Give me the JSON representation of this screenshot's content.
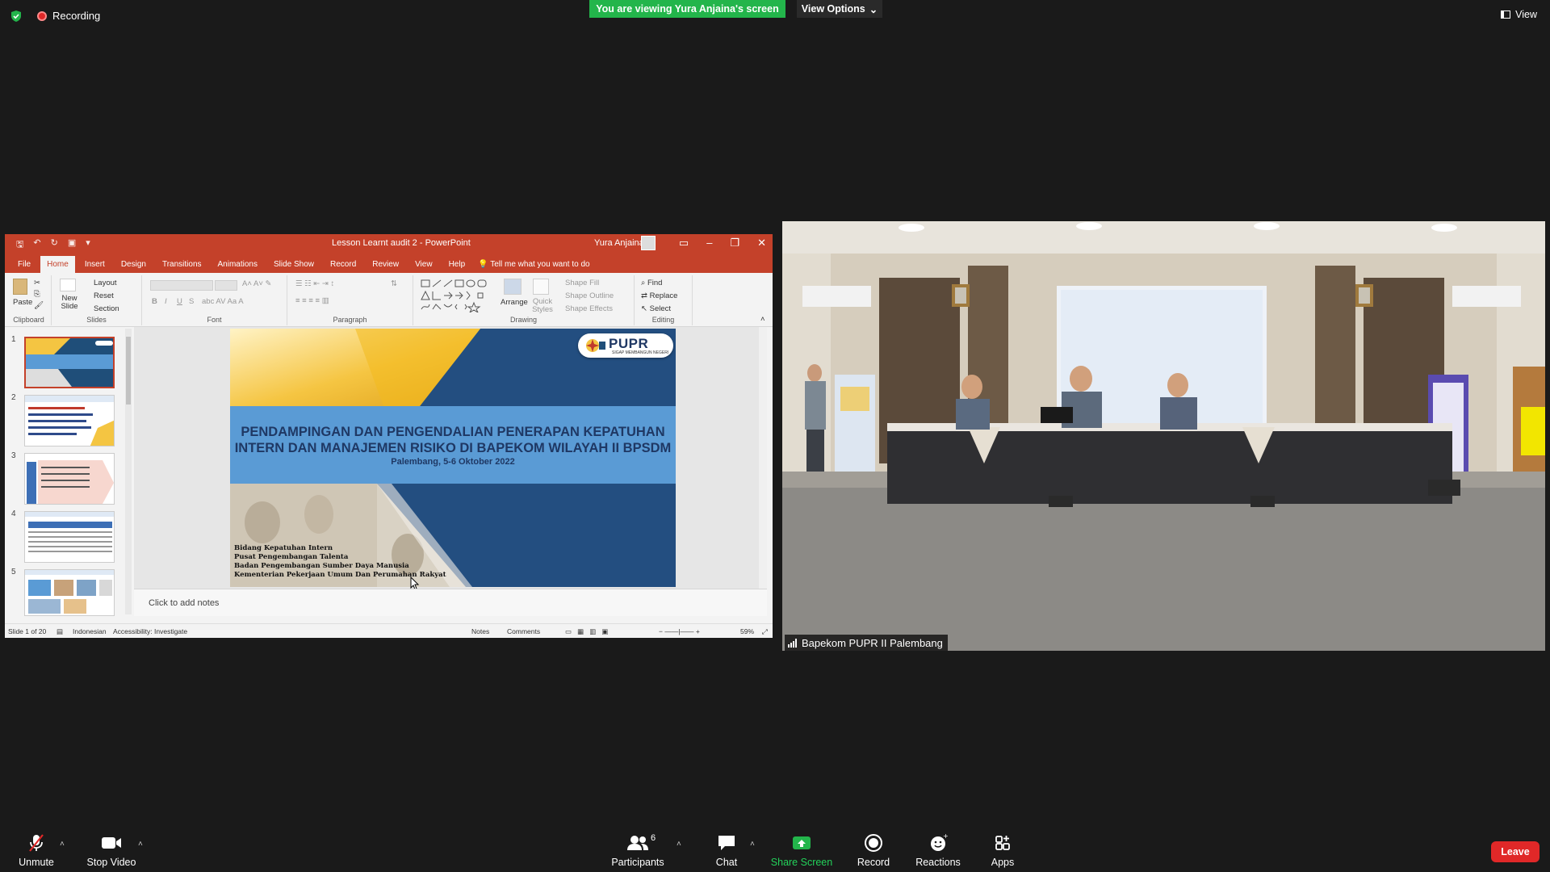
{
  "meeting": {
    "recording_label": "Recording",
    "viewing_banner": "You are viewing Yura Anjaina's screen",
    "view_options_label": "View Options",
    "view_label": "View",
    "colors": {
      "banner_green": "#23b54b",
      "leave_red": "#e02828",
      "ppt_accent": "#c4412a"
    }
  },
  "powerpoint": {
    "title": "Lesson Learnt audit 2  -  PowerPoint",
    "user": "Yura Anjaina",
    "tabs": [
      "File",
      "Home",
      "Insert",
      "Design",
      "Transitions",
      "Animations",
      "Slide Show",
      "Record",
      "Review",
      "View",
      "Help"
    ],
    "active_tab": "Home",
    "tell_me": "Tell me what you want to do",
    "ribbon": {
      "clipboard": {
        "label": "Clipboard",
        "paste": "Paste"
      },
      "slides": {
        "label": "Slides",
        "new_slide": "New Slide",
        "layout": "Layout",
        "reset": "Reset",
        "section": "Section"
      },
      "font": {
        "label": "Font",
        "bold": "B",
        "italic": "I",
        "underline": "U",
        "strike": "S"
      },
      "paragraph": {
        "label": "Paragraph"
      },
      "drawing": {
        "label": "Drawing",
        "arrange": "Arrange",
        "quick_styles": "Quick Styles",
        "shape_fill": "Shape Fill",
        "shape_outline": "Shape Outline",
        "shape_effects": "Shape Effects"
      },
      "editing": {
        "label": "Editing",
        "find": "Find",
        "replace": "Replace",
        "select": "Select"
      }
    },
    "thumbnails": [
      {
        "number": "1",
        "active": true
      },
      {
        "number": "2",
        "active": false
      },
      {
        "number": "3",
        "active": false
      },
      {
        "number": "4",
        "active": false
      },
      {
        "number": "5",
        "active": false
      }
    ],
    "slide": {
      "logo_text": "PUPR",
      "logo_tagline": "SIGAP MEMBANGUN NEGERI",
      "title_line1": "PENDAMPINGAN DAN PENGENDALIAN PENERAPAN KEPATUHAN",
      "title_line2": "INTERN DAN MANAJEMEN RISIKO DI BAPEKOM WILAYAH II BPSDM",
      "subtitle": "Palembang, 5-6 Oktober 2022",
      "org_lines": [
        "Bidang Kepatuhan Intern",
        "Pusat Pengembangan Talenta",
        "Badan Pengembangan Sumber Daya Manusia",
        "Kementerian Pekerjaan Umum Dan Perumahan Rakyat"
      ]
    },
    "notes_placeholder": "Click to add notes",
    "status": {
      "slide_counter": "Slide 1 of 20",
      "language": "Indonesian",
      "accessibility": "Accessibility: Investigate",
      "notes": "Notes",
      "comments": "Comments",
      "zoom": "59%"
    }
  },
  "video": {
    "participant_name": "Bapekom PUPR II Palembang"
  },
  "toolbar": {
    "unmute": "Unmute",
    "stop_video": "Stop Video",
    "participants": "Participants",
    "participant_count": "6",
    "chat": "Chat",
    "share_screen": "Share Screen",
    "record": "Record",
    "reactions": "Reactions",
    "apps": "Apps",
    "leave": "Leave"
  }
}
